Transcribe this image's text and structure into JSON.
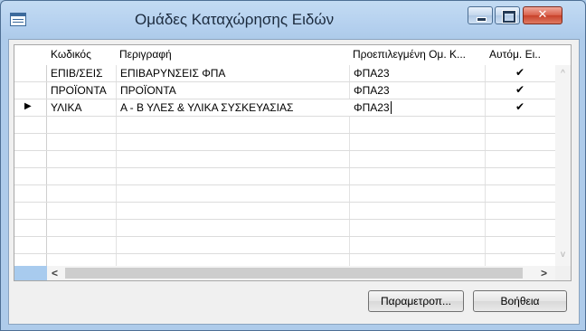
{
  "window": {
    "title": "Ομάδες Καταχώρησης Ειδών",
    "controls": {
      "minimize": "minimize",
      "maximize": "maximize",
      "close": "✕"
    }
  },
  "grid": {
    "columns": [
      "Κωδικός",
      "Περιγραφή",
      "Προεπιλεγμένη Ομ. Κ...",
      "Αυτόμ. Ει.."
    ],
    "rows": [
      {
        "code": "ΕΠΙΒ/ΣΕΙΣ",
        "description": "ΕΠΙΒΑΡΥΝΣΕΙΣ ΦΠΑ",
        "default_group": "ΦΠΑ23",
        "auto": "✔"
      },
      {
        "code": "ΠΡΟΪΟΝΤΑ",
        "description": "ΠΡΟΪΟΝΤΑ",
        "default_group": "ΦΠΑ23",
        "auto": "✔"
      },
      {
        "code": "ΥΛΙΚΑ",
        "description": "Α - Β ΥΛΕΣ & ΥΛΙΚΑ ΣΥΣΚΕΥΑΣΙΑΣ",
        "default_group": "ΦΠΑ23",
        "auto": "✔"
      }
    ],
    "current_row_marker": "▶",
    "lookup_icon": "arrow-up-icon",
    "lookup_glyph": "🠉",
    "scroll": {
      "left": "<",
      "right": ">",
      "up": "^",
      "down": "v"
    }
  },
  "buttons": {
    "parameters": "Παραμετροπ...",
    "help": "Βοήθεια"
  }
}
